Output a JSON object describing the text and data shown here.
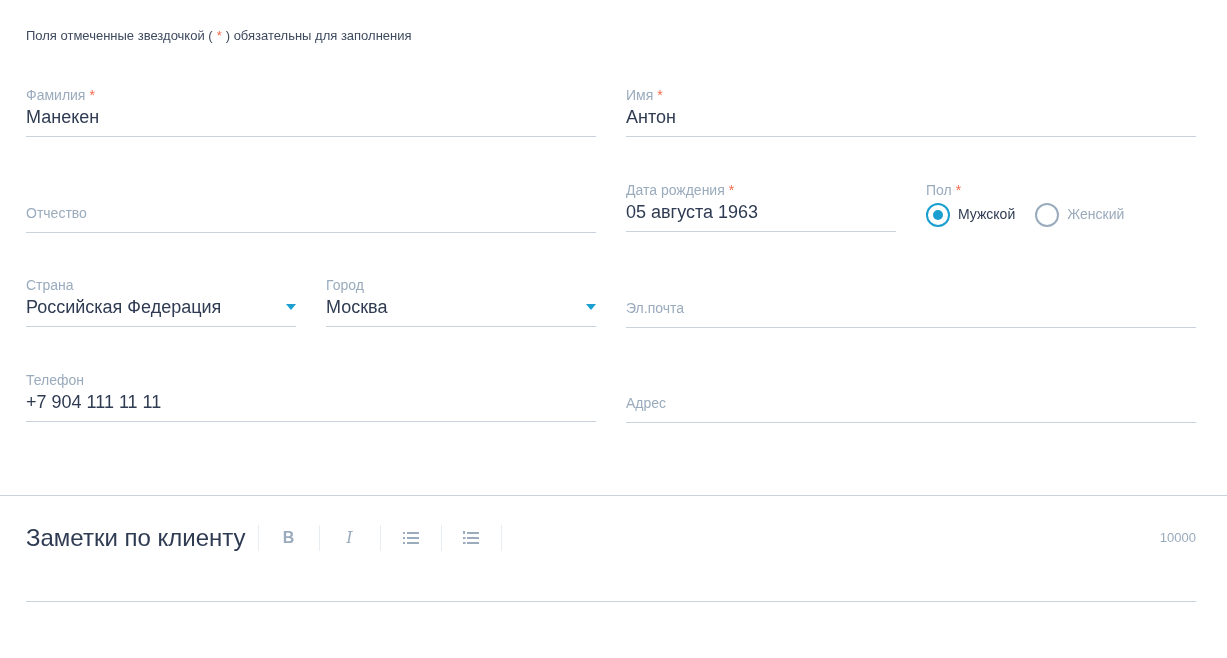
{
  "required_note": {
    "before": "Поля отмеченные звездочкой (",
    "mark": "*",
    "after": ") обязательны для заполнения"
  },
  "rows": [
    {
      "fields": [
        {
          "kind": "text",
          "label": "Фамилия",
          "required_mark": "*",
          "value": "Манекен"
        },
        {
          "kind": "text",
          "label": "Имя",
          "required_mark": "*",
          "value": "Антон"
        }
      ]
    },
    {
      "fields": [
        {
          "kind": "text",
          "label": "Отчество"
        },
        {
          "kind": "text",
          "label": "Дата рождения",
          "required_mark": "*",
          "value": "05 августа 1963"
        },
        {
          "kind": "radio",
          "label": "Пол",
          "required_mark": "*",
          "options": [
            {
              "label": "Мужской",
              "selected": true
            },
            {
              "label": "Женский",
              "selected": false
            }
          ]
        }
      ]
    },
    {
      "fields": [
        {
          "kind": "select",
          "label": "Страна",
          "value": "Российская Федерация"
        },
        {
          "kind": "select",
          "label": "Город",
          "value": "Москва"
        },
        {
          "kind": "text",
          "label": "Эл.почта"
        }
      ]
    },
    {
      "fields": [
        {
          "kind": "text",
          "label": "Телефон",
          "value": "+7 904 111 11 11"
        },
        {
          "kind": "text",
          "label": "Адрес"
        }
      ]
    }
  ],
  "notes": {
    "title": "Заметки по клиенту",
    "toolbar": [
      {
        "kind": "bold",
        "glyph": "B"
      },
      {
        "kind": "italic",
        "glyph": "I"
      },
      {
        "kind": "bullet-list"
      },
      {
        "kind": "numbered-list"
      }
    ],
    "counter": "10000"
  }
}
